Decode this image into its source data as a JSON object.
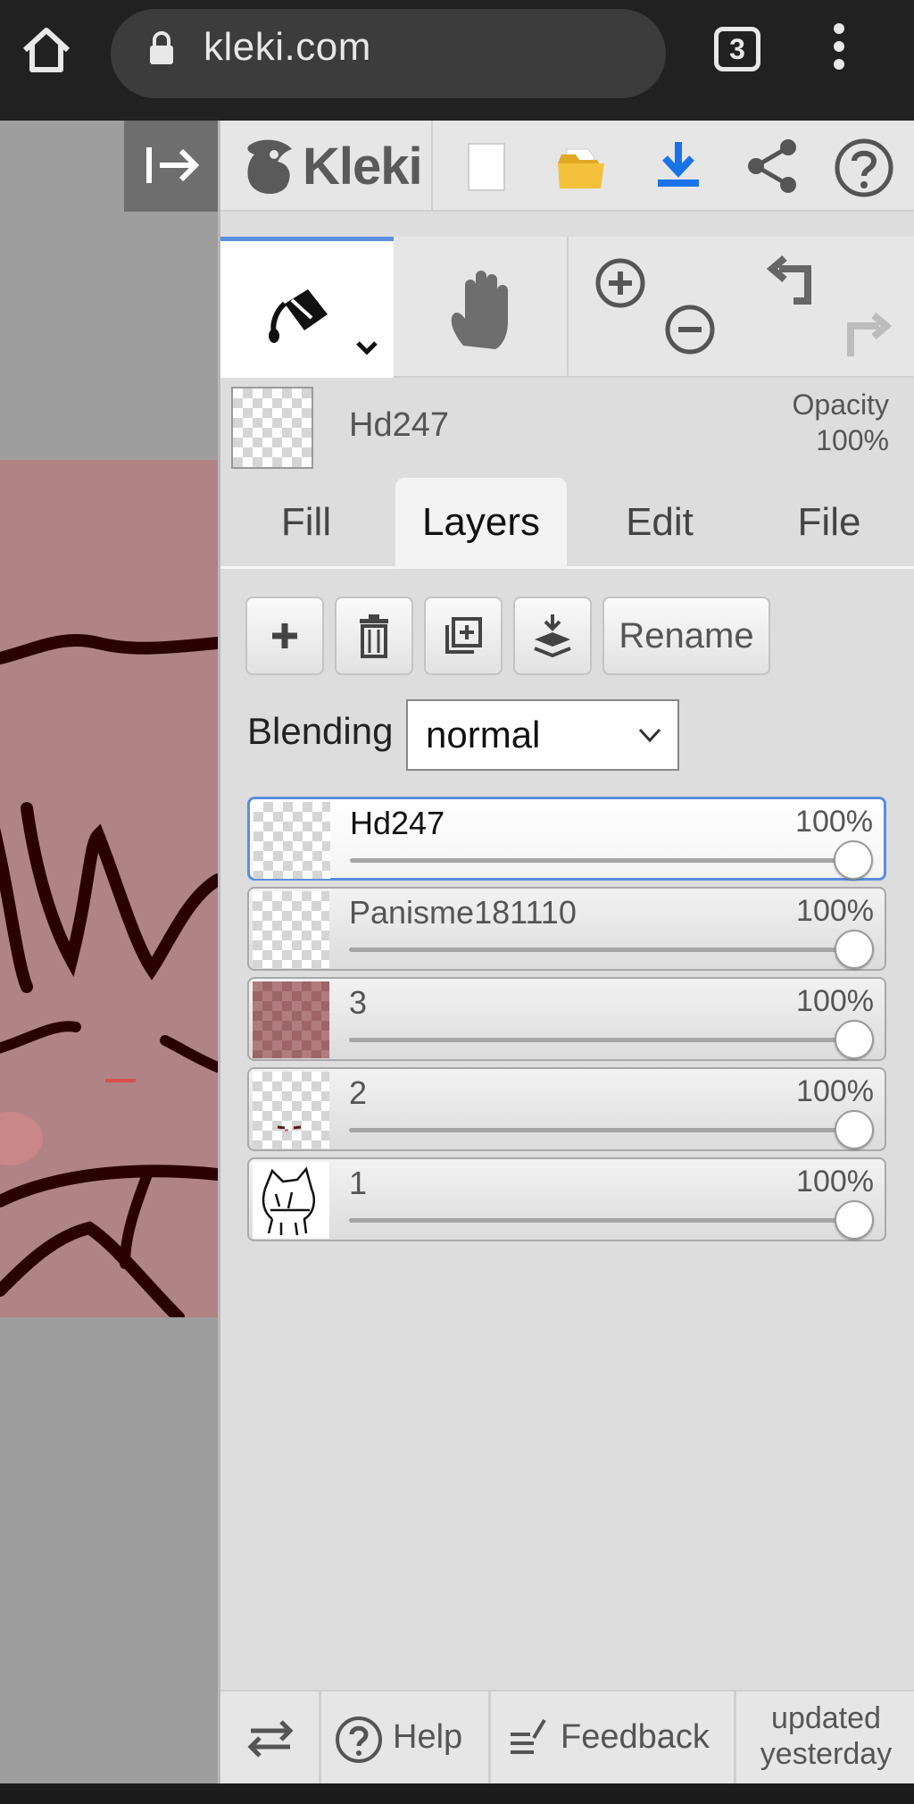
{
  "browser": {
    "url": "kleki.com",
    "tab_count": "3"
  },
  "app": {
    "logo_text": "Kleki"
  },
  "active_layer": {
    "name": "Hd247",
    "opacity_label": "Opacity",
    "opacity_value": "100%"
  },
  "tabs": [
    {
      "label": "Fill"
    },
    {
      "label": "Layers"
    },
    {
      "label": "Edit"
    },
    {
      "label": "File"
    }
  ],
  "layer_buttons": {
    "rename_label": "Rename"
  },
  "blending": {
    "label": "Blending",
    "value": "normal"
  },
  "layers": [
    {
      "name": "Hd247",
      "opacity": "100%",
      "level": 1.0,
      "selected": true
    },
    {
      "name": "Panisme181110",
      "opacity": "100%",
      "level": 1.0,
      "selected": false
    },
    {
      "name": "3",
      "opacity": "100%",
      "level": 1.0,
      "selected": false
    },
    {
      "name": "2",
      "opacity": "100%",
      "level": 1.0,
      "selected": false
    },
    {
      "name": "1",
      "opacity": "100%",
      "level": 1.0,
      "selected": false
    }
  ],
  "footer": {
    "help_label": "Help",
    "feedback_label": "Feedback",
    "updated_line1": "updated",
    "updated_line2": "yesterday"
  },
  "colors": {
    "accent": "#5b8ede",
    "download": "#1a73e8",
    "folder": "#f4c13a",
    "artwork_bg": "#b08384",
    "stroke": "#2a0000"
  }
}
